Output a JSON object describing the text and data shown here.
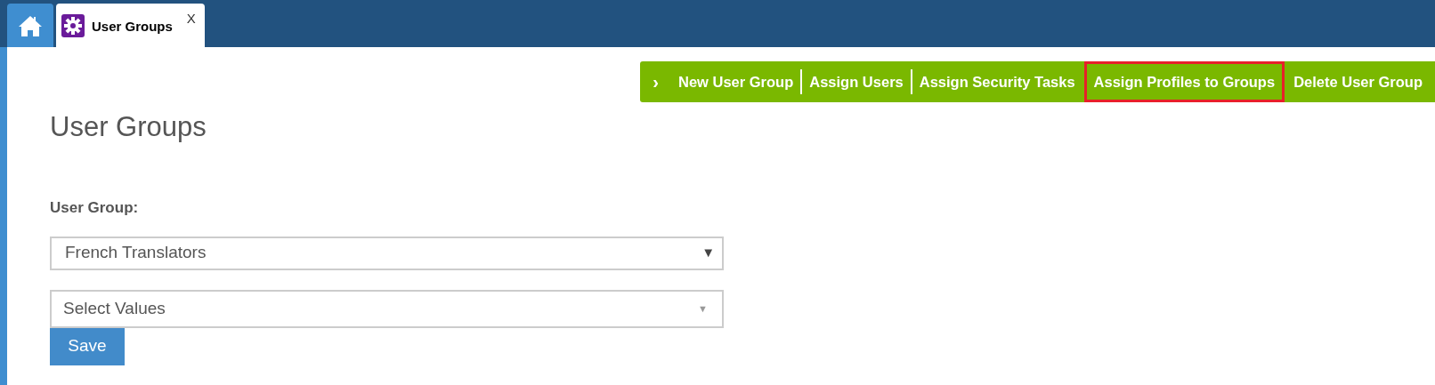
{
  "tabs": [
    {
      "label": "User Groups",
      "close": "X",
      "selected": true
    }
  ],
  "actions": {
    "chevron": "›",
    "items": [
      {
        "label": "New User Group",
        "highlighted": false
      },
      {
        "label": "Assign Users",
        "highlighted": false
      },
      {
        "label": "Assign Security Tasks",
        "highlighted": false
      },
      {
        "label": "Assign Profiles to Groups",
        "highlighted": true
      },
      {
        "label": "Delete User Group",
        "highlighted": false
      }
    ]
  },
  "page_title": "User Groups",
  "form": {
    "label": "User Group:",
    "group_select": {
      "value": "French Translators",
      "arrow": "▼"
    },
    "values_select": {
      "placeholder": "Select Values",
      "arrow": "▼"
    },
    "save": "Save"
  }
}
